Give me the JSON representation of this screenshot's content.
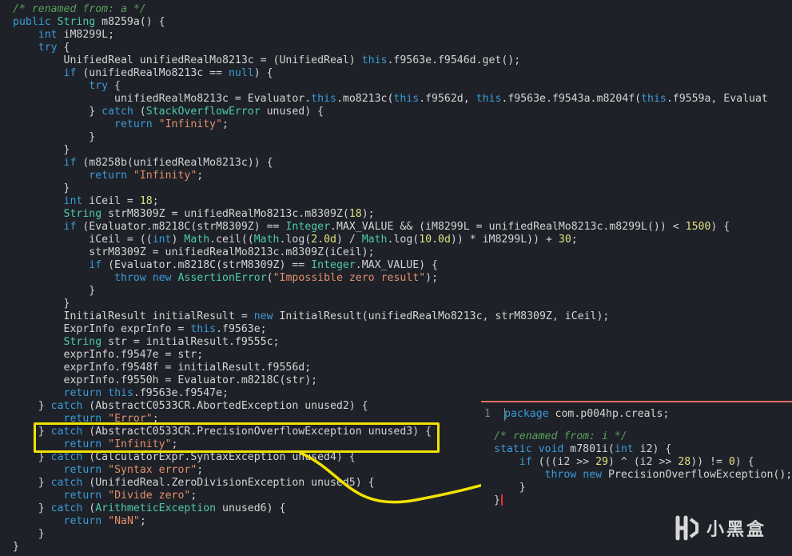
{
  "main_code": [
    [
      {
        "t": "/* renamed from: a */",
        "c": "cmt"
      }
    ],
    [
      {
        "t": "public",
        "c": "kw"
      },
      {
        "t": " "
      },
      {
        "t": "String",
        "c": "typ"
      },
      {
        "t": " m8259a() {"
      }
    ],
    [
      {
        "t": "    "
      },
      {
        "t": "int",
        "c": "kw"
      },
      {
        "t": " iM8299L;"
      }
    ],
    [
      {
        "t": "    "
      },
      {
        "t": "try",
        "c": "kw"
      },
      {
        "t": " {"
      }
    ],
    [
      {
        "t": "        UnifiedReal unifiedRealMo8213c = (UnifiedReal) "
      },
      {
        "t": "this",
        "c": "kw"
      },
      {
        "t": ".f9563e.f9546d.get();"
      }
    ],
    [
      {
        "t": "        "
      },
      {
        "t": "if",
        "c": "kw"
      },
      {
        "t": " (unifiedRealMo8213c == "
      },
      {
        "t": "null",
        "c": "kw"
      },
      {
        "t": ") {"
      }
    ],
    [
      {
        "t": "            "
      },
      {
        "t": "try",
        "c": "kw"
      },
      {
        "t": " {"
      }
    ],
    [
      {
        "t": "                unifiedRealMo8213c = Evaluator."
      },
      {
        "t": "this",
        "c": "kw"
      },
      {
        "t": ".mo8213c("
      },
      {
        "t": "this",
        "c": "kw"
      },
      {
        "t": ".f9562d, "
      },
      {
        "t": "this",
        "c": "kw"
      },
      {
        "t": ".f9563e.f9543a.m8204f("
      },
      {
        "t": "this",
        "c": "kw"
      },
      {
        "t": ".f9559a, Evaluat"
      }
    ],
    [
      {
        "t": "            } "
      },
      {
        "t": "catch",
        "c": "kw"
      },
      {
        "t": " ("
      },
      {
        "t": "StackOverflowError",
        "c": "typ"
      },
      {
        "t": " unused) {"
      }
    ],
    [
      {
        "t": "                "
      },
      {
        "t": "return",
        "c": "kw"
      },
      {
        "t": " "
      },
      {
        "t": "\"Infinity\"",
        "c": "str"
      },
      {
        "t": ";"
      }
    ],
    [
      {
        "t": "            }"
      }
    ],
    [
      {
        "t": "        }"
      }
    ],
    [
      {
        "t": "        "
      },
      {
        "t": "if",
        "c": "kw"
      },
      {
        "t": " (m8258b(unifiedRealMo8213c)) {"
      }
    ],
    [
      {
        "t": "            "
      },
      {
        "t": "return",
        "c": "kw"
      },
      {
        "t": " "
      },
      {
        "t": "\"Infinity\"",
        "c": "str"
      },
      {
        "t": ";"
      }
    ],
    [
      {
        "t": "        }"
      }
    ],
    [
      {
        "t": "        "
      },
      {
        "t": "int",
        "c": "kw"
      },
      {
        "t": " iCeil = "
      },
      {
        "t": "18",
        "c": "num"
      },
      {
        "t": ";"
      }
    ],
    [
      {
        "t": "        "
      },
      {
        "t": "String",
        "c": "typ"
      },
      {
        "t": " strM8309Z = unifiedRealMo8213c.m8309Z("
      },
      {
        "t": "18",
        "c": "num"
      },
      {
        "t": ");"
      }
    ],
    [
      {
        "t": "        "
      },
      {
        "t": "if",
        "c": "kw"
      },
      {
        "t": " (Evaluator.m8218C(strM8309Z) == "
      },
      {
        "t": "Integer",
        "c": "typ"
      },
      {
        "t": ".MAX_VALUE && (iM8299L = unifiedRealMo8213c.m8299L()) < "
      },
      {
        "t": "1500",
        "c": "num"
      },
      {
        "t": ") {"
      }
    ],
    [
      {
        "t": "            iCeil = (("
      },
      {
        "t": "int",
        "c": "kw"
      },
      {
        "t": ") "
      },
      {
        "t": "Math",
        "c": "typ"
      },
      {
        "t": ".ceil(("
      },
      {
        "t": "Math",
        "c": "typ"
      },
      {
        "t": ".log("
      },
      {
        "t": "2.0d",
        "c": "num"
      },
      {
        "t": ") / "
      },
      {
        "t": "Math",
        "c": "typ"
      },
      {
        "t": ".log("
      },
      {
        "t": "10.0d",
        "c": "num"
      },
      {
        "t": ")) * iM8299L)) + "
      },
      {
        "t": "30",
        "c": "num"
      },
      {
        "t": ";"
      }
    ],
    [
      {
        "t": "            strM8309Z = unifiedRealMo8213c.m8309Z(iCeil);"
      }
    ],
    [
      {
        "t": "            "
      },
      {
        "t": "if",
        "c": "kw"
      },
      {
        "t": " (Evaluator.m8218C(strM8309Z) == "
      },
      {
        "t": "Integer",
        "c": "typ"
      },
      {
        "t": ".MAX_VALUE) {"
      }
    ],
    [
      {
        "t": "                "
      },
      {
        "t": "throw",
        "c": "kw"
      },
      {
        "t": " "
      },
      {
        "t": "new",
        "c": "kw"
      },
      {
        "t": " "
      },
      {
        "t": "AssertionError",
        "c": "typ"
      },
      {
        "t": "("
      },
      {
        "t": "\"Impossible zero result\"",
        "c": "str"
      },
      {
        "t": ");"
      }
    ],
    [
      {
        "t": "            }"
      }
    ],
    [
      {
        "t": "        }"
      }
    ],
    [
      {
        "t": "        InitialResult initialResult = "
      },
      {
        "t": "new",
        "c": "kw"
      },
      {
        "t": " InitialResult(unifiedRealMo8213c, strM8309Z, iCeil);"
      }
    ],
    [
      {
        "t": "        ExprInfo exprInfo = "
      },
      {
        "t": "this",
        "c": "kw"
      },
      {
        "t": ".f9563e;"
      }
    ],
    [
      {
        "t": "        "
      },
      {
        "t": "String",
        "c": "typ"
      },
      {
        "t": " str = initialResult.f9555c;"
      }
    ],
    [
      {
        "t": "        exprInfo.f9547e = str;"
      }
    ],
    [
      {
        "t": "        exprInfo.f9548f = initialResult.f9556d;"
      }
    ],
    [
      {
        "t": "        exprInfo.f9550h = Evaluator.m8218C(str);"
      }
    ],
    [
      {
        "t": "        "
      },
      {
        "t": "return",
        "c": "kw"
      },
      {
        "t": " "
      },
      {
        "t": "this",
        "c": "kw"
      },
      {
        "t": ".f9563e.f9547e;"
      }
    ],
    [
      {
        "t": "    } "
      },
      {
        "t": "catch",
        "c": "kw"
      },
      {
        "t": " (AbstractC0533CR.AbortedException unused2) {"
      }
    ],
    [
      {
        "t": "        "
      },
      {
        "t": "return",
        "c": "kw"
      },
      {
        "t": " "
      },
      {
        "t": "\"Error\"",
        "c": "str"
      },
      {
        "t": ";"
      }
    ],
    [
      {
        "t": "    } "
      },
      {
        "t": "catch",
        "c": "kw"
      },
      {
        "t": " (AbstractC0533CR.PrecisionOverflowException unused3) {"
      }
    ],
    [
      {
        "t": "        "
      },
      {
        "t": "return",
        "c": "kw"
      },
      {
        "t": " "
      },
      {
        "t": "\"Infinity\"",
        "c": "str"
      },
      {
        "t": ";"
      }
    ],
    [
      {
        "t": "    } "
      },
      {
        "t": "catch",
        "c": "kw"
      },
      {
        "t": " (CalculatorExpr.SyntaxException unused4) {"
      }
    ],
    [
      {
        "t": "        "
      },
      {
        "t": "return",
        "c": "kw"
      },
      {
        "t": " "
      },
      {
        "t": "\"Syntax error\"",
        "c": "str"
      },
      {
        "t": ";"
      }
    ],
    [
      {
        "t": "    } "
      },
      {
        "t": "catch",
        "c": "kw"
      },
      {
        "t": " (UnifiedReal.ZeroDivisionException unused5) {"
      }
    ],
    [
      {
        "t": "        "
      },
      {
        "t": "return",
        "c": "kw"
      },
      {
        "t": " "
      },
      {
        "t": "\"Divide zero\"",
        "c": "str"
      },
      {
        "t": ";"
      }
    ],
    [
      {
        "t": "    } "
      },
      {
        "t": "catch",
        "c": "kw"
      },
      {
        "t": " ("
      },
      {
        "t": "ArithmeticException",
        "c": "typ"
      },
      {
        "t": " unused6) {"
      }
    ],
    [
      {
        "t": "        "
      },
      {
        "t": "return",
        "c": "kw"
      },
      {
        "t": " "
      },
      {
        "t": "\"NaN\"",
        "c": "str"
      },
      {
        "t": ";"
      }
    ],
    [
      {
        "t": "    }"
      }
    ],
    [
      {
        "t": "}"
      }
    ]
  ],
  "panel": {
    "line_number": "1",
    "lines": [
      [
        {
          "t": "package",
          "c": "kw"
        },
        {
          "t": " com.p004hp.creals;"
        }
      ],
      [
        {
          "t": ""
        }
      ],
      [
        {
          "t": "/* renamed from: i */",
          "c": "cmt"
        }
      ],
      [
        {
          "t": "static",
          "c": "kw"
        },
        {
          "t": " "
        },
        {
          "t": "void",
          "c": "kw"
        },
        {
          "t": " m7801i("
        },
        {
          "t": "int",
          "c": "kw"
        },
        {
          "t": " i2) {"
        }
      ],
      [
        {
          "t": "    "
        },
        {
          "t": "if",
          "c": "kw"
        },
        {
          "t": " (((i2 >> "
        },
        {
          "t": "29",
          "c": "num"
        },
        {
          "t": ") ^ (i2 >> "
        },
        {
          "t": "28",
          "c": "num"
        },
        {
          "t": ")) != "
        },
        {
          "t": "0",
          "c": "num"
        },
        {
          "t": ") {"
        }
      ],
      [
        {
          "t": "        "
        },
        {
          "t": "throw",
          "c": "kw"
        },
        {
          "t": " "
        },
        {
          "t": "new",
          "c": "kw"
        },
        {
          "t": " PrecisionOverflowException();"
        }
      ],
      [
        {
          "t": "    }"
        }
      ],
      [
        {
          "t": "}"
        }
      ]
    ]
  },
  "watermark": {
    "text": "小黑盒"
  },
  "colors": {
    "highlight": "#f2e200",
    "arrow": "#f2e200",
    "panel_border": "#e0705f"
  }
}
